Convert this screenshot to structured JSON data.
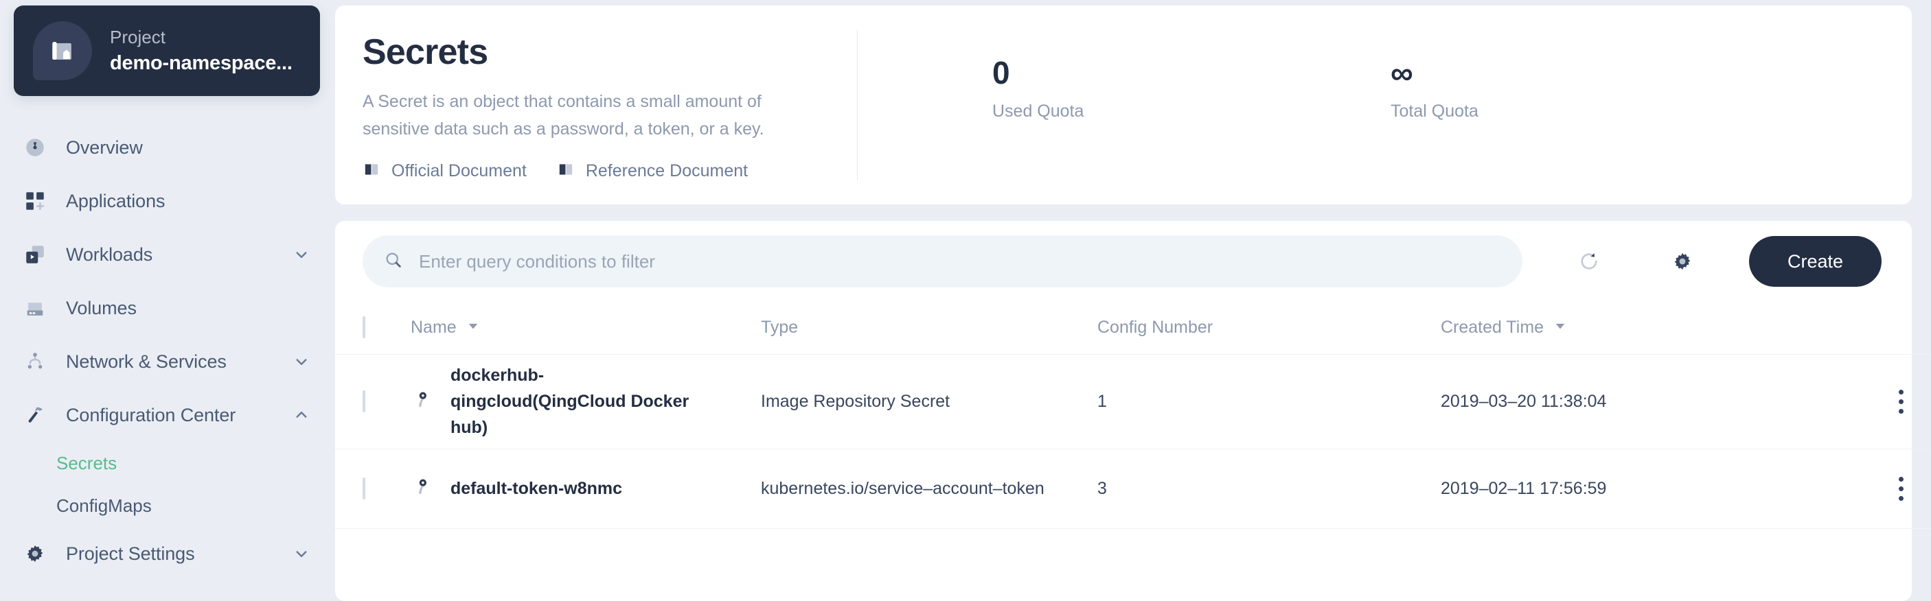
{
  "sidebar": {
    "project": {
      "kicker": "Project",
      "name": "demo-namespace...",
      "icon": "project-logo-icon"
    },
    "items": [
      {
        "label": "Overview",
        "icon": "dashboard-icon",
        "expandable": false,
        "expanded": false
      },
      {
        "label": "Applications",
        "icon": "applications-icon",
        "expandable": false,
        "expanded": false
      },
      {
        "label": "Workloads",
        "icon": "workloads-icon",
        "expandable": true,
        "expanded": false
      },
      {
        "label": "Volumes",
        "icon": "volumes-icon",
        "expandable": false,
        "expanded": false
      },
      {
        "label": "Network & Services",
        "icon": "network-icon",
        "expandable": true,
        "expanded": false
      },
      {
        "label": "Configuration Center",
        "icon": "hammer-icon",
        "expandable": true,
        "expanded": true
      },
      {
        "label": "Project Settings",
        "icon": "gear-icon",
        "expandable": true,
        "expanded": false
      }
    ],
    "sub_items": [
      {
        "label": "Secrets",
        "active": true
      },
      {
        "label": "ConfigMaps",
        "active": false
      }
    ]
  },
  "banner": {
    "title": "Secrets",
    "description": "A Secret is an object that contains a small amount of sensitive data such as a password, a token, or a key.",
    "links": [
      {
        "label": "Official Document",
        "icon": "book-icon"
      },
      {
        "label": "Reference Document",
        "icon": "book-icon"
      }
    ],
    "stats": [
      {
        "value": "0",
        "label": "Used Quota"
      },
      {
        "value": "∞",
        "label": "Total Quota"
      }
    ]
  },
  "toolbar": {
    "search_placeholder": "Enter query conditions to filter",
    "search_value": "",
    "search_icon": "search-icon",
    "refresh_icon": "refresh-icon",
    "settings_icon": "gear-icon",
    "create_label": "Create"
  },
  "table": {
    "columns": [
      {
        "label": "Name",
        "sortable": true
      },
      {
        "label": "Type",
        "sortable": false
      },
      {
        "label": "Config Number",
        "sortable": false
      },
      {
        "label": "Created Time",
        "sortable": true
      }
    ],
    "rows": [
      {
        "name": "dockerhub-qingcloud(QingCloud Docker hub)",
        "type": "Image Repository Secret",
        "config_number": "1",
        "created_time": "2019–03–20 11:38:04",
        "icon": "key-icon"
      },
      {
        "name": "default-token-w8nmc",
        "type": "kubernetes.io/service–account–token",
        "config_number": "3",
        "created_time": "2019–02–11 17:56:59",
        "icon": "key-icon"
      }
    ]
  },
  "colors": {
    "accent_dark": "#242e42",
    "active_green": "#55bc8a",
    "page_bg": "#eaeef4",
    "muted_text": "#8d99ae"
  }
}
